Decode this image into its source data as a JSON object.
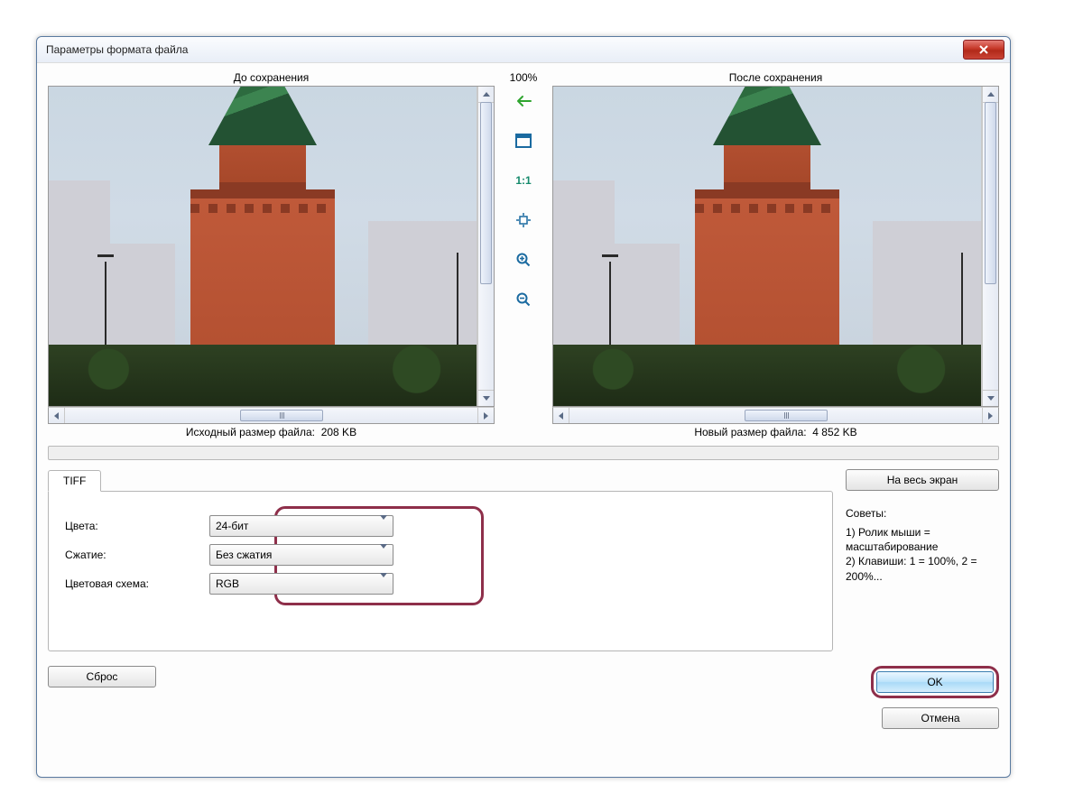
{
  "window": {
    "title": "Параметры формата файла"
  },
  "zoom": {
    "percent": "100%",
    "ratio_label": "1:1"
  },
  "preview": {
    "before_label": "До сохранения",
    "after_label": "После сохранения",
    "original_size_label": "Исходный размер файла:",
    "original_size_value": "208 KB",
    "new_size_label": "Новый размер файла:",
    "new_size_value": "4 852 KB"
  },
  "tab": {
    "label": "TIFF"
  },
  "form": {
    "colors": {
      "label": "Цвета:",
      "value": "24-бит"
    },
    "compression": {
      "label": "Сжатие:",
      "value": "Без сжатия"
    },
    "color_scheme": {
      "label": "Цветовая схема:",
      "value": "RGB"
    }
  },
  "buttons": {
    "fullscreen": "На весь экран",
    "reset": "Сброс",
    "ok": "OK",
    "cancel": "Отмена"
  },
  "tips": {
    "title": "Советы:",
    "line1": "1) Ролик мыши = масштабирование",
    "line2": "2) Клавиши: 1 = 100%, 2 = 200%..."
  },
  "icons": {
    "close": "close-icon",
    "arrow_left": "arrow-left-icon",
    "fit": "fit-window-icon",
    "ratio": "ratio-1to1-icon",
    "center": "center-icon",
    "zoom_in": "zoom-in-icon",
    "zoom_out": "zoom-out-icon"
  },
  "colors": {
    "highlight": "#8e2f4a",
    "primary_btn": "#a9daf8"
  }
}
